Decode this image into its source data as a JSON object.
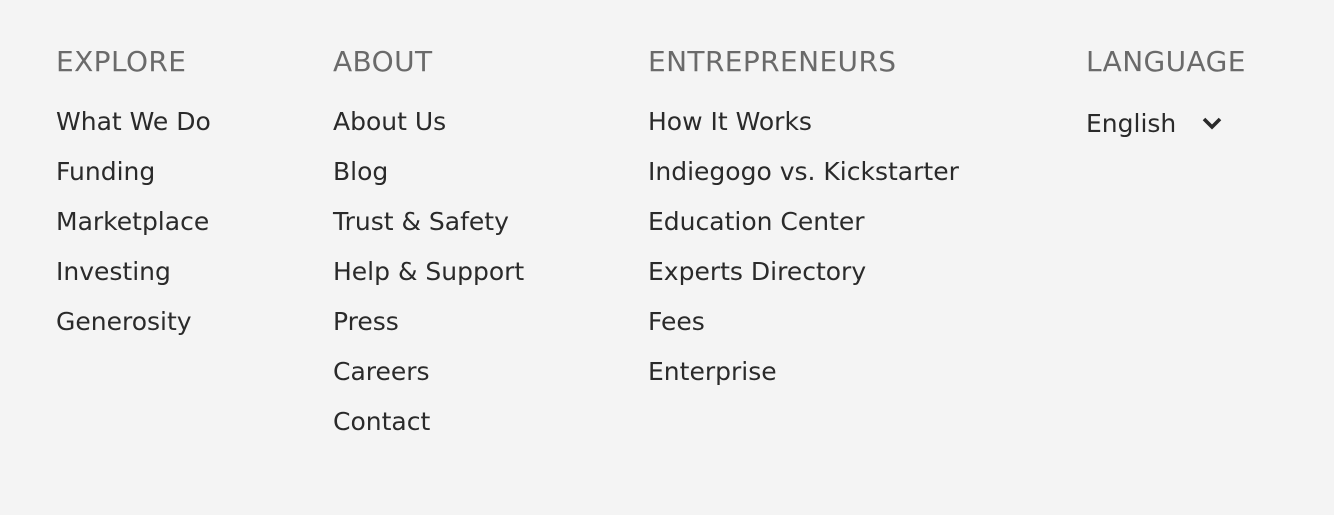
{
  "explore": {
    "heading": "EXPLORE",
    "items": [
      "What We Do",
      "Funding",
      "Marketplace",
      "Investing",
      "Generosity"
    ]
  },
  "about": {
    "heading": "ABOUT",
    "items": [
      "About Us",
      "Blog",
      "Trust & Safety",
      "Help & Support",
      "Press",
      "Careers",
      "Contact"
    ]
  },
  "entrepreneurs": {
    "heading": "ENTREPRENEURS",
    "items": [
      "How It Works",
      "Indiegogo vs. Kickstarter",
      "Education Center",
      "Experts Directory",
      "Fees",
      "Enterprise"
    ]
  },
  "language": {
    "heading": "LANGUAGE",
    "selected": "English",
    "icon": "chevron-down-icon"
  },
  "colors": {
    "background": "#f4f4f4",
    "heading": "#6a6a6a",
    "link": "#2a2a2a"
  }
}
